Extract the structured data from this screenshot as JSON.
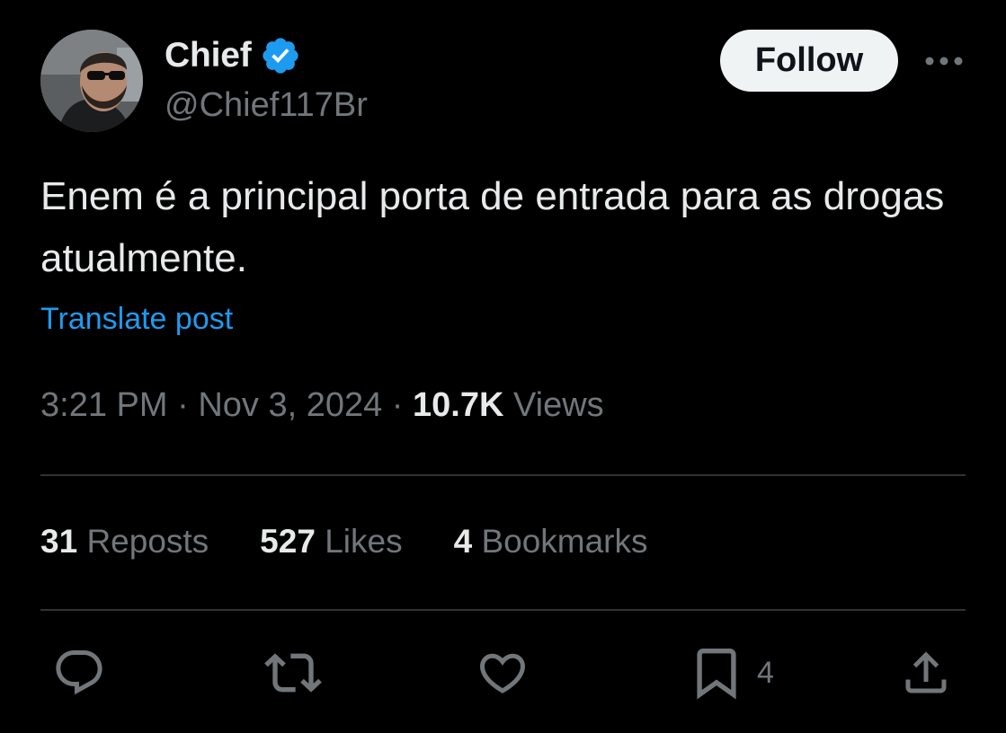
{
  "author": {
    "display_name": "Chief",
    "handle": "@Chief117Br",
    "verified": true,
    "verified_color": "#1d9bf0"
  },
  "header": {
    "follow_label": "Follow",
    "more_icon": "more-horizontal-icon"
  },
  "post": {
    "text": "Enem é a principal porta de entrada para as drogas atualmente.",
    "translate_label": "Translate post"
  },
  "meta": {
    "time": "3:21 PM",
    "separator": "·",
    "date": "Nov 3, 2024",
    "views_count": "10.7K",
    "views_label": "Views"
  },
  "stats": {
    "reposts_count": "31",
    "reposts_label": "Reposts",
    "likes_count": "527",
    "likes_label": "Likes",
    "bookmarks_count": "4",
    "bookmarks_label": "Bookmarks"
  },
  "actions": {
    "reply_icon": "reply-icon",
    "repost_icon": "repost-icon",
    "like_icon": "heart-icon",
    "bookmark_icon": "bookmark-icon",
    "bookmark_count": "4",
    "share_icon": "share-icon"
  },
  "colors": {
    "background": "#000000",
    "text_primary": "#e7e9ea",
    "text_secondary": "#71767b",
    "accent": "#1d9bf0",
    "divider": "#2f3336",
    "follow_bg": "#eff3f4"
  }
}
